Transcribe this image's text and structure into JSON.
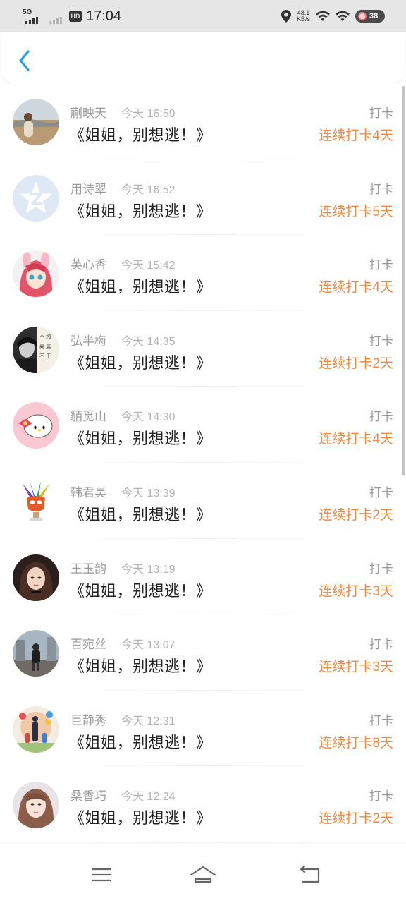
{
  "status_bar": {
    "network_label": "5G",
    "hd_label": "HD",
    "time": "17:04",
    "speed_value": "48.1",
    "speed_unit": "KB/s",
    "battery": "38",
    "icons": [
      "signal-icon",
      "hd-icon",
      "location-icon",
      "wifi-icon",
      "battery-icon"
    ]
  },
  "header": {
    "back_icon": "chevron-left-icon",
    "accent_color": "#2b9cdb"
  },
  "records": [
    {
      "name": "蒯映天",
      "time": "今天 16:59",
      "title": "《姐姐，别想逃！》",
      "type": "打卡",
      "streak": "连续打卡4天",
      "avatar": "photo-landscape"
    },
    {
      "name": "用诗翠",
      "time": "今天 16:52",
      "title": "《姐姐，别想逃！》",
      "type": "打卡",
      "streak": "连续打卡5天",
      "avatar": "default-qq-avatar"
    },
    {
      "name": "英心香",
      "time": "今天 15:42",
      "title": "《姐姐，别想逃！》",
      "type": "打卡",
      "streak": "连续打卡4天",
      "avatar": "anime-girl"
    },
    {
      "name": "弘半梅",
      "time": "今天 14:35",
      "title": "《姐姐，别想逃！》",
      "type": "打卡",
      "streak": "连续打卡2天",
      "avatar": "bw-portrait"
    },
    {
      "name": "貊觅山",
      "time": "今天 14:30",
      "title": "《姐姐，别想逃！》",
      "type": "打卡",
      "streak": "连续打卡4天",
      "avatar": "hello-kitty"
    },
    {
      "name": "韩君昊",
      "time": "今天 13:39",
      "title": "《姐姐，别想逃！》",
      "type": "打卡",
      "streak": "连续打卡2天",
      "avatar": "carnival-mask"
    },
    {
      "name": "王玉韵",
      "time": "今天 13:19",
      "title": "《姐姐，别想逃！》",
      "type": "打卡",
      "streak": "连续打卡3天",
      "avatar": "dark-hair-girl"
    },
    {
      "name": "百宛丝",
      "time": "今天 13:07",
      "title": "《姐姐，别想逃！》",
      "type": "打卡",
      "streak": "连续打卡3天",
      "avatar": "street-photo"
    },
    {
      "name": "巨静秀",
      "time": "今天 12:31",
      "title": "《姐姐，别想逃！》",
      "type": "打卡",
      "streak": "连续打卡8天",
      "avatar": "family-illustration"
    },
    {
      "name": "桑香巧",
      "time": "今天 12:24",
      "title": "《姐姐，别想逃！》",
      "type": "打卡",
      "streak": "连续打卡2天",
      "avatar": "girl-selfie"
    }
  ],
  "colors": {
    "streak": "#ef8a45",
    "name": "#9b9b9b",
    "title": "#222222"
  },
  "nav": {
    "icons": [
      "menu-icon",
      "home-icon",
      "back-icon"
    ]
  }
}
